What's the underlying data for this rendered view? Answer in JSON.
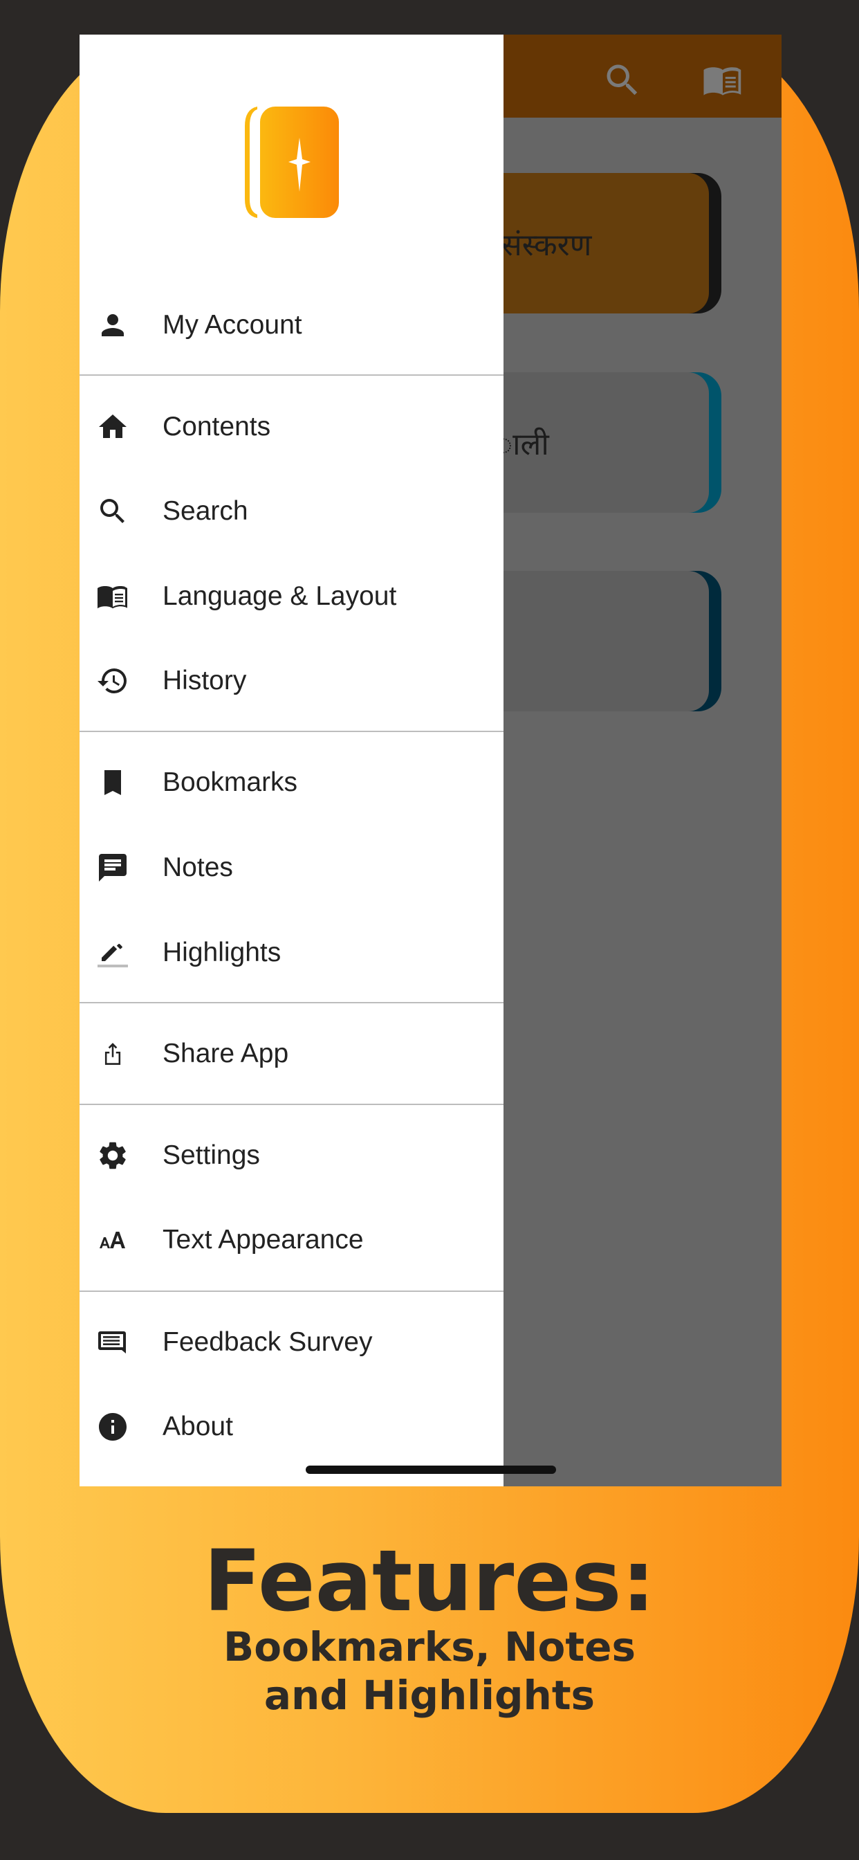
{
  "colors": {
    "background": "#2b2826",
    "frame_left": "#ffc94f",
    "frame_right": "#fb8a10",
    "appbar": "#653604",
    "overlay": "#666666",
    "drawer": "#ffffff",
    "text": "#222222"
  },
  "appbar": {
    "icons": [
      "search-icon",
      "book-open-icon"
    ]
  },
  "cards": [
    {
      "label": "संस्करण",
      "color": "#653e0c",
      "edge": "#151515"
    },
    {
      "label": "ाली",
      "color": "#5e5e5e",
      "edge": "#00546b"
    },
    {
      "label": "",
      "color": "#5e5e5e",
      "edge": "#002a3c"
    }
  ],
  "drawer": {
    "logo": "app-logo-book-star",
    "items": [
      {
        "label": "My Account",
        "icon": "person-icon"
      },
      {
        "label": "Contents",
        "icon": "home-icon"
      },
      {
        "label": "Search",
        "icon": "search-icon"
      },
      {
        "label": "Language & Layout",
        "icon": "book-open-icon"
      },
      {
        "label": "History",
        "icon": "history-icon"
      },
      {
        "label": "Bookmarks",
        "icon": "bookmark-icon"
      },
      {
        "label": "Notes",
        "icon": "note-icon"
      },
      {
        "label": "Highlights",
        "icon": "highlight-pen-icon"
      },
      {
        "label": "Share App",
        "icon": "share-icon"
      },
      {
        "label": "Settings",
        "icon": "gear-icon"
      },
      {
        "label": "Text Appearance",
        "icon": "text-size-icon"
      },
      {
        "label": "Feedback Survey",
        "icon": "feedback-icon"
      },
      {
        "label": "About",
        "icon": "info-icon"
      }
    ]
  },
  "caption": {
    "title": "Features:",
    "line1": "Bookmarks, Notes",
    "line2": "and Highlights"
  }
}
